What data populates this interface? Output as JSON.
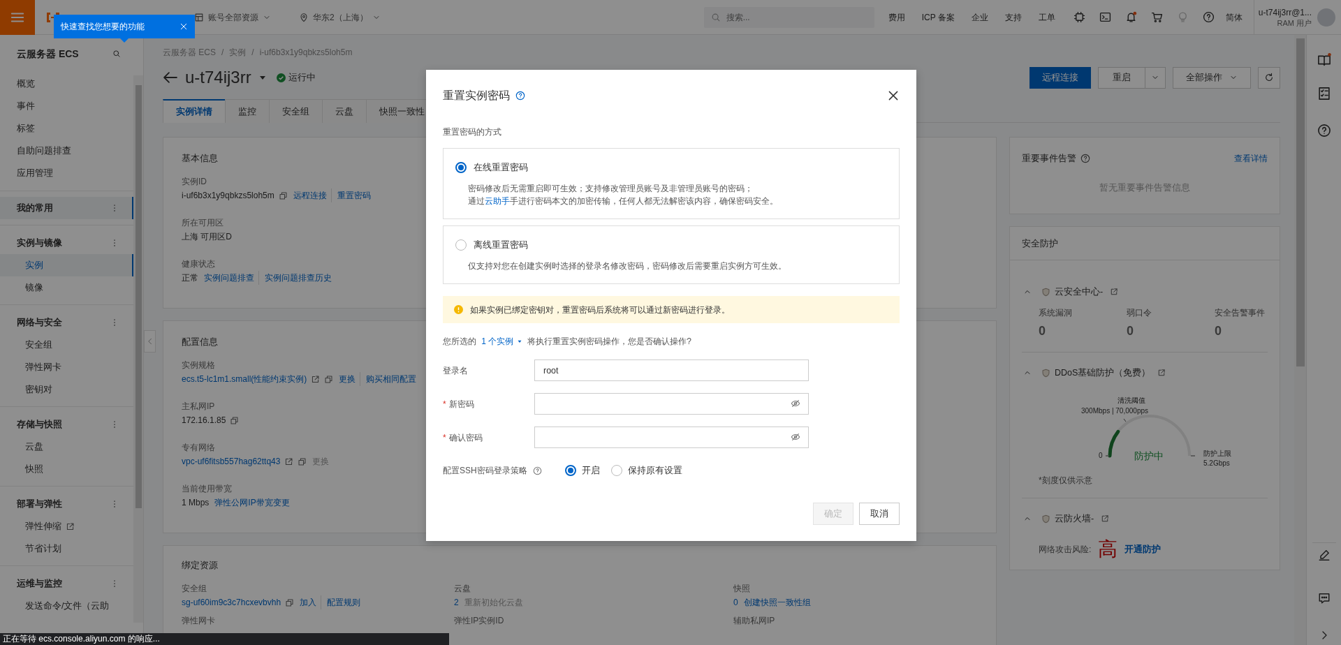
{
  "topbar": {
    "account_scope": "账号全部资源",
    "region": "华东2（上海）",
    "search": {
      "placeholder": "搜索..."
    },
    "links": [
      "费用",
      "ICP 备案",
      "企业",
      "支持",
      "工单"
    ],
    "bell_badge": true,
    "language": "简体",
    "user": {
      "name": "u-t74ij3rr@1...",
      "role": "RAM 用户"
    }
  },
  "tooltip": {
    "text": "快速查找您想要的功能"
  },
  "sidebar": {
    "title": "云服务器 ECS",
    "top_items": [
      {
        "label": "概览",
        "selected": false
      },
      {
        "label": "事件",
        "selected": false
      },
      {
        "label": "标签",
        "selected": false
      },
      {
        "label": "自助问题排查",
        "selected": false
      },
      {
        "label": "应用管理",
        "selected": false
      }
    ],
    "groups": [
      {
        "label": "我的常用",
        "selected": true
      },
      {
        "label": "实例与镜像",
        "selected": false,
        "items": [
          {
            "label": "实例",
            "selected": true
          },
          {
            "label": "镜像",
            "selected": false
          }
        ]
      },
      {
        "label": "网络与安全",
        "selected": false,
        "items": [
          {
            "label": "安全组",
            "selected": false
          },
          {
            "label": "弹性网卡",
            "selected": false
          },
          {
            "label": "密钥对",
            "selected": false
          }
        ]
      },
      {
        "label": "存储与快照",
        "selected": false,
        "items": [
          {
            "label": "云盘",
            "selected": false
          },
          {
            "label": "快照",
            "selected": false
          }
        ]
      },
      {
        "label": "部署与弹性",
        "selected": false,
        "items": [
          {
            "label": "弹性伸缩",
            "selected": false,
            "external": true
          },
          {
            "label": "节省计划",
            "selected": false
          }
        ]
      },
      {
        "label": "运维与监控",
        "selected": false,
        "items": [
          {
            "label": "发送命令/文件（云助",
            "selected": false
          }
        ]
      }
    ]
  },
  "breadcrumb": {
    "separator": "/",
    "items": [
      "云服务器 ECS",
      "实例",
      "i-uf6b3x1y9qbkzs5loh5m"
    ]
  },
  "instance": {
    "name": "u-t74ij3rr",
    "status": "运行中"
  },
  "actions": {
    "remote": "远程连接",
    "restart": "重启",
    "all": "全部操作"
  },
  "tabs": [
    {
      "label": "实例详情",
      "selected": true
    },
    {
      "label": "监控",
      "selected": false
    },
    {
      "label": "安全组",
      "selected": false
    },
    {
      "label": "云盘",
      "selected": false
    },
    {
      "label": "快照一致性",
      "selected": false
    }
  ],
  "basic_info": {
    "title": "基本信息",
    "fields": [
      {
        "label": "实例ID",
        "value": "i-uf6b3x1y9qbkzs5loh5m",
        "copy": true,
        "links": [
          {
            "text": "远程连接",
            "disabled": false
          },
          {
            "text": "重置密码",
            "disabled": false
          }
        ]
      },
      {
        "label": "所在可用区",
        "value": "上海 可用区D"
      },
      {
        "label": "健康状态",
        "value": "正常",
        "links": [
          {
            "text": "实例问题排查",
            "disabled": false
          },
          {
            "text": "实例问题排查历史",
            "disabled": false
          }
        ]
      }
    ]
  },
  "config_info": {
    "title": "配置信息",
    "fields": [
      {
        "label": "实例规格",
        "value": "ecs.t5-lc1m1.small(性能约束实例)",
        "value_link": true,
        "external": true,
        "copy": true,
        "links": [
          {
            "text": "更换",
            "disabled": false
          },
          {
            "text": "购买相同配置",
            "disabled": false
          }
        ]
      },
      {
        "label": "主私网IP",
        "value": "172.16.1.85",
        "copy": true
      },
      {
        "label": "专有网络",
        "value": "vpc-uf6fitsb557hag62ttq43",
        "value_link": true,
        "external": true,
        "copy": true,
        "links": [
          {
            "text": "更换",
            "disabled": true
          }
        ]
      },
      {
        "label": "当前使用带宽",
        "value": "1 Mbps",
        "links": [
          {
            "text": "弹性公网IP带宽变更",
            "disabled": false
          }
        ]
      }
    ]
  },
  "bound_resources": {
    "title": "绑定资源",
    "fields": [
      {
        "label": "安全组",
        "value": "sg-uf60im9c3c7hcxevbvhh",
        "value_link": true,
        "copy": true,
        "links": [
          {
            "text": "加入",
            "disabled": false
          },
          {
            "text": "配置规则",
            "disabled": false
          }
        ]
      },
      {
        "label": "云盘",
        "value": "2",
        "value_link": true,
        "links": [
          {
            "text": "重新初始化云盘",
            "disabled": true
          }
        ]
      },
      {
        "label": "快照",
        "value": "0",
        "value_link": true,
        "links": [
          {
            "text": "创建快照一致性组",
            "disabled": false
          }
        ]
      }
    ],
    "more_labels": [
      "弹性网卡",
      "弹性IP实例ID",
      "辅助私网IP"
    ]
  },
  "event_alerts": {
    "title": "重要事件告警",
    "link": "查看详情",
    "empty": "暂无重要事件告警信息"
  },
  "security": {
    "title": "安全防护",
    "sections": [
      {
        "kind": "stats",
        "title": "云安全中心-",
        "expanded": true,
        "stats": [
          {
            "label": "系统漏洞",
            "value": "0"
          },
          {
            "label": "弱口令",
            "value": "0"
          },
          {
            "label": "安全告警事件",
            "value": "0"
          }
        ]
      },
      {
        "kind": "gauge",
        "title": "DDoS基础防护（免费）",
        "expanded": true,
        "gauge": {
          "threshold_label": "清洗阈值",
          "threshold": "300Mbps | 70,000pps",
          "min": "0",
          "status": "防护中",
          "max_label": "防护上限",
          "max": "5.2Gbps"
        },
        "note": "*刻度仅供示意"
      },
      {
        "kind": "risk",
        "title": "云防火墙-",
        "expanded": true,
        "label": "网络攻击风险:",
        "risk": "高",
        "link": "开通防护"
      }
    ]
  },
  "right_rail": {
    "guide_badge": true
  },
  "dialog": {
    "title": "重置实例密码",
    "method_label": "重置密码的方式",
    "methods": [
      {
        "title": "在线重置密码",
        "selected": true,
        "description": [
          {
            "text": "密码修改后无需重启即可生效；支持修改管理员账号及非管理员账号的密码；"
          },
          {
            "text": "通过",
            "link": "云助手",
            "after": "手进行密码本文的加密传输，任何人都无法解密该内容，确保密码安全。"
          }
        ]
      },
      {
        "title": "离线重置密码",
        "selected": false,
        "description": [
          {
            "text": "仅支持对您在创建实例时选择的登录名修改密码，密码修改后需要重启实例方可生效。"
          }
        ]
      }
    ],
    "warning": "如果实例已绑定密钥对，重置密码后系统将可以通过新密码进行登录。",
    "confirm": {
      "before": "您所选的",
      "link": "1 个实例",
      "after": "将执行重置实例密码操作，您是否确认操作?"
    },
    "required_mark": "*",
    "fields": [
      {
        "label": "登录名",
        "kind": "text",
        "value": "root",
        "required": false
      },
      {
        "label": "新密码",
        "kind": "password",
        "required": true
      },
      {
        "label": "确认密码",
        "kind": "password",
        "required": true
      }
    ],
    "ssh_policy": {
      "label": "配置SSH密码登录策略",
      "options": [
        {
          "label": "开启",
          "selected": true
        },
        {
          "label": "保持原有设置",
          "selected": false
        }
      ]
    },
    "buttons": [
      {
        "label": "确定",
        "kind": "primary",
        "disabled": true
      },
      {
        "label": "取消",
        "kind": "default",
        "disabled": false
      }
    ]
  },
  "status_bar": "正在等待 ecs.console.aliyun.com 的响应..."
}
